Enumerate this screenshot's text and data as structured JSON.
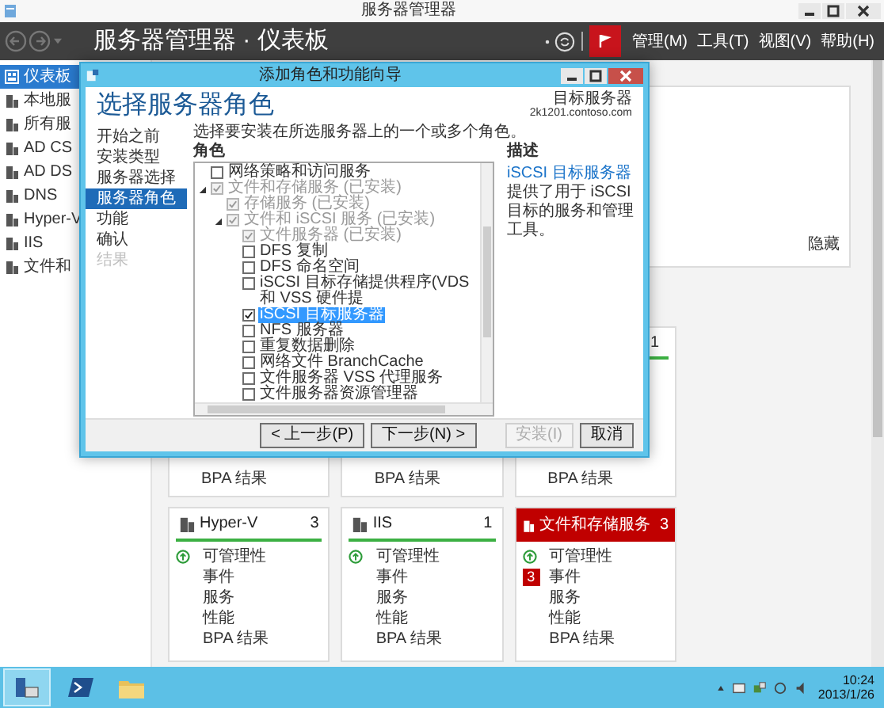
{
  "window": {
    "title": "服务器管理器"
  },
  "header": {
    "title": "服务器管理器 · 仪表板",
    "menus": [
      "管理(M)",
      "工具(T)",
      "视图(V)",
      "帮助(H)"
    ]
  },
  "sidebar": {
    "items": [
      {
        "label": "仪表板",
        "selected": true
      },
      {
        "label": "本地服",
        "selected": false
      },
      {
        "label": "所有服",
        "selected": false
      },
      {
        "label": "AD CS",
        "selected": false
      },
      {
        "label": "AD DS",
        "selected": false
      },
      {
        "label": "DNS",
        "selected": false
      },
      {
        "label": "Hyper-V",
        "selected": false
      },
      {
        "label": "IIS",
        "selected": false
      },
      {
        "label": "文件和",
        "selected": false
      }
    ]
  },
  "welcome_panel": {
    "hide_link": "隐藏"
  },
  "tiles_row_1": [
    {
      "items": [
        "BPA 结果"
      ]
    },
    {
      "items": [
        "BPA 结果"
      ]
    },
    {
      "count": "1",
      "items": [
        "BPA 结果"
      ]
    }
  ],
  "tiles_row_2": [
    {
      "name": "Hyper-V",
      "count": "3",
      "alert": false,
      "items": [
        {
          "label": "可管理性",
          "kind": "ok"
        },
        {
          "label": "事件",
          "kind": "plain"
        },
        {
          "label": "服务",
          "kind": "plain"
        },
        {
          "label": "性能",
          "kind": "plain"
        },
        {
          "label": "BPA 结果",
          "kind": "plain"
        }
      ]
    },
    {
      "name": "IIS",
      "count": "1",
      "alert": false,
      "items": [
        {
          "label": "可管理性",
          "kind": "ok"
        },
        {
          "label": "事件",
          "kind": "plain"
        },
        {
          "label": "服务",
          "kind": "plain"
        },
        {
          "label": "性能",
          "kind": "plain"
        },
        {
          "label": "BPA 结果",
          "kind": "plain"
        }
      ]
    },
    {
      "name": "文件和存储服务",
      "count": "3",
      "alert": true,
      "items": [
        {
          "label": "可管理性",
          "kind": "ok"
        },
        {
          "label": "事件",
          "kind": "badge",
          "badge": "3"
        },
        {
          "label": "服务",
          "kind": "plain"
        },
        {
          "label": "性能",
          "kind": "plain"
        },
        {
          "label": "BPA 结果",
          "kind": "plain"
        }
      ]
    }
  ],
  "dialog": {
    "title": "添加角色和功能向导",
    "heading": "选择服务器角色",
    "target_label": "目标服务器",
    "target_server": "2k1201.contoso.com",
    "steps": [
      {
        "label": "开始之前",
        "selected": false,
        "disabled": false
      },
      {
        "label": "安装类型",
        "selected": false,
        "disabled": false
      },
      {
        "label": "服务器选择",
        "selected": false,
        "disabled": false
      },
      {
        "label": "服务器角色",
        "selected": true,
        "disabled": false
      },
      {
        "label": "功能",
        "selected": false,
        "disabled": false
      },
      {
        "label": "确认",
        "selected": false,
        "disabled": false
      },
      {
        "label": "结果",
        "selected": false,
        "disabled": true
      }
    ],
    "instruction": "选择要安装在所选服务器上的一个或多个角色。",
    "roles_label": "角色",
    "roles": [
      {
        "label": "网络策略和访问服务",
        "checked": false,
        "disabled": false,
        "selected": false
      },
      {
        "label": "文件和存储服务 (已安装)",
        "checked": true,
        "disabled": true,
        "selected": false,
        "expanded": true,
        "children": [
          {
            "label": "存储服务 (已安装)",
            "checked": true,
            "disabled": true,
            "selected": false
          },
          {
            "label": "文件和 iSCSI 服务 (已安装)",
            "checked": true,
            "disabled": true,
            "selected": false,
            "expanded": true,
            "children": [
              {
                "label": "文件服务器 (已安装)",
                "checked": true,
                "disabled": true,
                "selected": false
              },
              {
                "label": "DFS 复制",
                "checked": false,
                "disabled": false,
                "selected": false
              },
              {
                "label": "DFS 命名空间",
                "checked": false,
                "disabled": false,
                "selected": false
              },
              {
                "label": "iSCSI 目标存储提供程序(VDS 和 VSS 硬件提",
                "checked": false,
                "disabled": false,
                "selected": false
              },
              {
                "label": "iSCSI 目标服务器",
                "checked": true,
                "disabled": false,
                "selected": true
              },
              {
                "label": "NFS 服务器",
                "checked": false,
                "disabled": false,
                "selected": false
              },
              {
                "label": "重复数据删除",
                "checked": false,
                "disabled": false,
                "selected": false
              },
              {
                "label": "网络文件 BranchCache",
                "checked": false,
                "disabled": false,
                "selected": false
              },
              {
                "label": "文件服务器 VSS 代理服务",
                "checked": false,
                "disabled": false,
                "selected": false
              },
              {
                "label": "文件服务器资源管理器",
                "checked": false,
                "disabled": false,
                "selected": false
              }
            ]
          }
        ]
      }
    ],
    "description_label": "描述",
    "description_link": "iSCSI 目标服务器",
    "description_text": "提供了用于 iSCSI 目标的服务和管理工具。",
    "buttons": [
      {
        "label": "< 上一步(P)",
        "disabled": false
      },
      {
        "label": "下一步(N) >",
        "disabled": false
      },
      {
        "label": "安装(I)",
        "disabled": true
      },
      {
        "label": "取消",
        "disabled": false
      }
    ]
  },
  "taskbar": {
    "time": "10:24",
    "date": "2013/1/26"
  }
}
